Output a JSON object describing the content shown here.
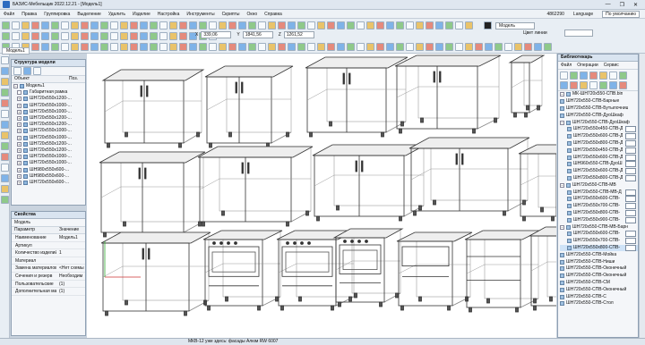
{
  "app": {
    "title": "БАЗИС-Мебельщик 2022.12.21 - [Модель1]",
    "min": "—",
    "max": "❐",
    "close": "✕"
  },
  "menu": {
    "items": [
      "Файл",
      "Правка",
      "Группировка",
      "Выделение",
      "Удалить",
      "Изделие",
      "Настройка",
      "Инструменты",
      "Скрипты",
      "Окно",
      "Справка"
    ],
    "code": "4862290",
    "language": "Language",
    "default_label": "По умолчанию"
  },
  "toolbar": {
    "x_label": "X",
    "x_value": "339,06",
    "y_label": "Y",
    "y_value": "1841,56",
    "z_label": "Z",
    "z_value": "1261,52",
    "model_select": "Модель",
    "line_color_label": "Цвет линии",
    "color_names": [
      "dark",
      "gray",
      "light",
      "blue",
      "teal"
    ]
  },
  "doc_tab": "Модель1",
  "structure": {
    "title": "Структура модели",
    "col_object": "Объект",
    "col_pos": "Поз.",
    "rows": [
      {
        "label": "Модель1",
        "exp": "−"
      },
      {
        "label": "Габаритная рамка",
        "exp": ""
      },
      {
        "label": "ШН720х550х1200-...",
        "exp": "+"
      },
      {
        "label": "ШН720х550х1000-...",
        "exp": "+"
      },
      {
        "label": "ШН720х550х1000-...",
        "exp": "+"
      },
      {
        "label": "ШН720х550х1200-...",
        "exp": "+"
      },
      {
        "label": "ШН720х550х1200-...",
        "exp": "+"
      },
      {
        "label": "ШН720х550х1000-...",
        "exp": "+"
      },
      {
        "label": "ШН720х550х1000-...",
        "exp": "+"
      },
      {
        "label": "ШН720х550х1200-...",
        "exp": "+"
      },
      {
        "label": "ШН720х550х1200-...",
        "exp": "+"
      },
      {
        "label": "ШН720х550х1000-...",
        "exp": "+"
      },
      {
        "label": "ШН720х550х1000-...",
        "exp": "+"
      },
      {
        "label": "ШН980х550х600-...",
        "exp": "+"
      },
      {
        "label": "ШН980х550х600-...",
        "exp": "+"
      },
      {
        "label": "ШН720х550х600-...",
        "exp": "+"
      }
    ]
  },
  "properties": {
    "title": "Свойства",
    "object": "Модель",
    "col_param": "Параметр",
    "col_value": "Значение",
    "rows": [
      {
        "k": "Наименование",
        "v": "Модель1"
      },
      {
        "k": "Артикул",
        "v": ""
      },
      {
        "k": "Количество изделий",
        "v": "1"
      },
      {
        "k": "Материал",
        "v": ""
      },
      {
        "k": "Замена материалов",
        "v": "<Нет схемы"
      },
      {
        "k": "Сечения и резерв",
        "v": "Необходим"
      },
      {
        "k": "Пользовательские",
        "v": "(1)"
      },
      {
        "k": "Дополнительная мат",
        "v": "(1)"
      }
    ]
  },
  "library": {
    "title": "Библиотекарь",
    "menus": [
      "Файл",
      "Операции",
      "Сервис"
    ],
    "rows": [
      {
        "label": "МК-ШН720х550-СПВ.bin",
        "exp": "−",
        "sel": false,
        "thumb": false
      },
      {
        "label": "ШН720х550-СПВ-Барные",
        "exp": "",
        "sel": false,
        "thumb": false
      },
      {
        "label": "ШН720х550-СПВ-Бутылочниц",
        "exp": "",
        "sel": false,
        "thumb": false
      },
      {
        "label": "ШН720х550-СПВ-ДуоШкаф",
        "exp": "",
        "sel": false,
        "thumb": false
      },
      {
        "label": "ШН720х550-СПВ-ДуоШкаф",
        "exp": "−",
        "sel": false,
        "thumb": false
      },
      {
        "label": "ШН720х550х450-СПВ-Д",
        "exp": "",
        "sel": false,
        "thumb": true
      },
      {
        "label": "ШН720х550х600-СПВ-Д",
        "exp": "",
        "sel": false,
        "thumb": true
      },
      {
        "label": "ШН720х550х800-СПВ-Д",
        "exp": "",
        "sel": false,
        "thumb": true
      },
      {
        "label": "ШН720х550х450-СПВ-Д",
        "exp": "",
        "sel": false,
        "thumb": true
      },
      {
        "label": "ШН720х550х600-СПВ-Д",
        "exp": "",
        "sel": false,
        "thumb": true
      },
      {
        "label": "ШН960х550-СПВ-ДуоШ",
        "exp": "",
        "sel": false,
        "thumb": true
      },
      {
        "label": "ШН720х550х600-СПВ-Д",
        "exp": "",
        "sel": false,
        "thumb": true
      },
      {
        "label": "ШН720х550х800-СПВ-Д",
        "exp": "",
        "sel": false,
        "thumb": true
      },
      {
        "label": "ШН720х550-СПВ-МВ",
        "exp": "−",
        "sel": false,
        "thumb": false
      },
      {
        "label": "ШН720х550-СПВ-МВ-Д",
        "exp": "",
        "sel": false,
        "thumb": true
      },
      {
        "label": "ШН720х550х600-СПВ-",
        "exp": "",
        "sel": false,
        "thumb": true
      },
      {
        "label": "ШН720х550х700-СПВ-",
        "exp": "",
        "sel": false,
        "thumb": true
      },
      {
        "label": "ШН720х550х800-СПВ-",
        "exp": "",
        "sel": false,
        "thumb": true
      },
      {
        "label": "ШН720х550х900-СПВ-",
        "exp": "",
        "sel": false,
        "thumb": true
      },
      {
        "label": "ШН720х550-СПВ-МВ-Барн",
        "exp": "−",
        "sel": false,
        "thumb": false
      },
      {
        "label": "ШН720х550х600-СПВ-",
        "exp": "",
        "sel": false,
        "thumb": true
      },
      {
        "label": "ШН720х550х700-СПВ-",
        "exp": "",
        "sel": false,
        "thumb": true
      },
      {
        "label": "ШН720х550х800-СПВ-",
        "exp": "",
        "sel": true,
        "thumb": true
      },
      {
        "label": "ШН720х550-СПВ-Мойка",
        "exp": "",
        "sel": false,
        "thumb": false
      },
      {
        "label": "ШН720х550-СПВ-Ниши",
        "exp": "",
        "sel": false,
        "thumb": false
      },
      {
        "label": "ШН720х550-СПВ-Оконечный",
        "exp": "",
        "sel": false,
        "thumb": false
      },
      {
        "label": "ШН720х550-СПВ-Оконечный",
        "exp": "",
        "sel": false,
        "thumb": false
      },
      {
        "label": "ШН720х550-СПВ-СМ",
        "exp": "",
        "sel": false,
        "thumb": false
      },
      {
        "label": "ШН720х550-СПВ-Оконечный",
        "exp": "",
        "sel": false,
        "thumb": false
      },
      {
        "label": "ШН720х550-СПВ-С",
        "exp": "",
        "sel": false,
        "thumb": false
      },
      {
        "label": "ШН720х550-СПВ-Стол",
        "exp": "",
        "sel": false,
        "thumb": false
      }
    ]
  },
  "status": {
    "text": "МКВ-12 уже здесь: фасады Алюм RW 6007"
  }
}
